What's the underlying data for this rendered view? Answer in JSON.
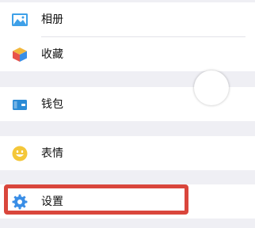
{
  "menu": {
    "items": [
      {
        "label": "相册",
        "icon": "photo-album-icon"
      },
      {
        "label": "收藏",
        "icon": "favorites-cube-icon"
      },
      {
        "label": "钱包",
        "icon": "wallet-icon"
      },
      {
        "label": "表情",
        "icon": "emoji-smiley-icon"
      },
      {
        "label": "设置",
        "icon": "settings-gear-icon"
      }
    ]
  },
  "colors": {
    "background": "#efeff4",
    "item_background": "#ffffff",
    "highlight": "#d9463c",
    "album_icon": "#3ea0e8",
    "wallet_icon": "#2b8bd6",
    "emoji_icon": "#f4c73a",
    "settings_icon": "#3a8ee6"
  }
}
